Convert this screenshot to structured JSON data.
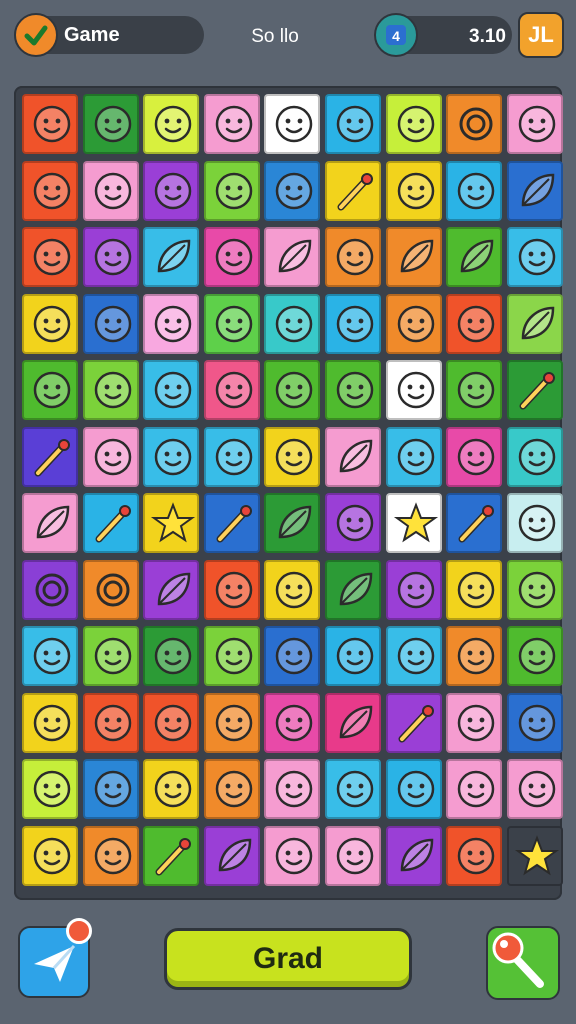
{
  "header": {
    "game_label": "Game",
    "center_text": "So llo",
    "score": "3.10",
    "score_badge_text": "4",
    "pause_icon": "pause-icon",
    "pause_text": "JL"
  },
  "board": {
    "rows": 12,
    "cols": 9,
    "tile_colors": [
      [
        "#f0532a",
        "#2c9b36",
        "#d8f03e",
        "#f59cd0",
        "#ffffff",
        "#2ab3e6",
        "#c6ef3a",
        "#f08a2a",
        "#f59cd0"
      ],
      [
        "#f0532a",
        "#f59cd0",
        "#9a3fd6",
        "#7bd23a",
        "#2a86d6",
        "#f2d31c",
        "#f2d31c",
        "#2ab3e6",
        "#2a6fd0"
      ],
      [
        "#f0532a",
        "#9a3fd6",
        "#38bde8",
        "#e84aa8",
        "#f59cd0",
        "#f08a2a",
        "#f08a2a",
        "#4fbb2e",
        "#38bde8"
      ],
      [
        "#f2d31c",
        "#2a6fd0",
        "#f8a8e0",
        "#5ed04a",
        "#38c9c9",
        "#2ab3e6",
        "#f08a2a",
        "#f0532a",
        "#8bd64a"
      ],
      [
        "#4fbb2e",
        "#7bd23a",
        "#38bde8",
        "#f0578a",
        "#4fbb2e",
        "#4fbb2e",
        "#ffffff",
        "#4fbb2e",
        "#2c9b36"
      ],
      [
        "#5a3fd6",
        "#f59cd0",
        "#38bde8",
        "#38bde8",
        "#f2d31c",
        "#f59cd0",
        "#38bde8",
        "#e84aa8",
        "#38c9c9"
      ],
      [
        "#f59cd0",
        "#2ab3e6",
        "#f2d31c",
        "#2a6fd0",
        "#2c9b36",
        "#9a3fd6",
        "#ffffff",
        "#2a6fd0",
        "#c8eef0"
      ],
      [
        "#8a3fd6",
        "#f08a2a",
        "#9a3fd6",
        "#f0532a",
        "#f2d31c",
        "#2c9b36",
        "#9a3fd6",
        "#f2d31c",
        "#7bd23a"
      ],
      [
        "#38bde8",
        "#7bd23a",
        "#2c9b36",
        "#7bd23a",
        "#2a6fd0",
        "#2ab3e6",
        "#38bde8",
        "#f08a2a",
        "#4fbb2e"
      ],
      [
        "#f2d31c",
        "#f0532a",
        "#f0532a",
        "#f08a2a",
        "#e84aa8",
        "#e83a8a",
        "#9a3fd6",
        "#f59cd0",
        "#2a6fd0"
      ],
      [
        "#c6ef3a",
        "#2a86d6",
        "#f2d31c",
        "#f08a2a",
        "#f59cd0",
        "#38bde8",
        "#2ab3e6",
        "#f59cd0",
        "#f59cd0"
      ],
      [
        "#f2d31c",
        "#f08a2a",
        "#4fbb2e",
        "#9a3fd6",
        "#f59cd0",
        "#f59cd0",
        "#9a3fd6",
        "#f0532a",
        "#3b414a"
      ]
    ],
    "tile_icons": [
      [
        "smiley-face-icon",
        "boy-face-icon",
        "smiley-face-icon",
        "apple-icon",
        "blue-drop-creature-icon",
        "blue-cat-icon",
        "lemon-icon",
        "swirl-icon",
        "plum-icon"
      ],
      [
        "orange-fruit-icon",
        "pink-face-icon",
        "purple-octopus-icon",
        "orange-face-icon",
        "frog-face-icon",
        "paintbrush-icon",
        "red-bird-icon",
        "green-dragon-icon",
        "red-feather-icon"
      ],
      [
        "cat-face-icon",
        "purple-monster-icon",
        "leaf-icon",
        "cheese-icon",
        "leaf-icon",
        "purple-bean-icon",
        "orange-leaf-icon",
        "carrot-leaf-icon",
        "blue-robot-icon"
      ],
      [
        "orange-fruit-icon",
        "green-face-icon",
        "pink-face-icon",
        "green-mountain-icon",
        "green-drop-icon",
        "blue-face-icon",
        "orange-drop-icon",
        "girl-face-icon",
        "green-leaf-icon"
      ],
      [
        "red-apple-icon",
        "red-fruit-icon",
        "purple-car-icon",
        "red-splat-icon",
        "yellow-cheese-icon",
        "red-apple-icon",
        "bear-face-icon",
        "red-bird-icon",
        "pencil-icon"
      ],
      [
        "paintbrush-icon",
        "orange-face-icon",
        "purple-plum-icon",
        "white-cat-icon",
        "orange-face-icon",
        "red-leaf-icon",
        "white-cat-icon",
        "pink-cat-icon",
        "green-face-icon"
      ],
      [
        "green-leaf-icon",
        "paintbrush-icon",
        "star-icon",
        "lollipop-icon",
        "red-leaf-icon",
        "blue-robot-icon",
        "star-icon",
        "green-brush-icon",
        "gray-face-icon"
      ],
      [
        "purple-swirl-icon",
        "target-icon",
        "feather-icon",
        "green-face-icon",
        "orange-face-icon",
        "green-feather-icon",
        "red-face-icon",
        "white-ghost-icon",
        "girl-face-icon"
      ],
      [
        "boy-face-icon",
        "orange-face-icon",
        "pink-face-icon",
        "yellow-face-icon",
        "white-ghost-icon",
        "red-face-icon",
        "boy-face-icon",
        "girl-face-icon",
        "pink-cat-icon"
      ],
      [
        "boy-face-icon",
        "red-robot-icon",
        "green-face-icon",
        "green-face-icon",
        "blue-berry-icon",
        "red-leaf-icon",
        "blue-pencil-icon",
        "girl-face-icon",
        "red-face-icon"
      ],
      [
        "lemon-icon",
        "radish-icon",
        "gray-face-icon",
        "boy-face-icon",
        "boy-face-icon",
        "pink-cat-icon",
        "green-face-icon",
        "boy-face-icon",
        "boy-face-icon"
      ],
      [
        "green-cat-icon",
        "orange-cat-icon",
        "lollipop-icon",
        "yellow-leaf-icon",
        "yellow-face-icon",
        "yellow-face-icon",
        "yellow-leaf-icon",
        "purple-face-icon",
        "star-icon"
      ]
    ]
  },
  "footer": {
    "left_icon": "paper-plane-icon",
    "main_button_label": "Grad",
    "right_icon": "magic-wand-icon"
  },
  "colors": {
    "background": "#5b6470",
    "board": "#3b414a",
    "main_button": "#c8e21e",
    "pause_button": "#f2a22c"
  }
}
